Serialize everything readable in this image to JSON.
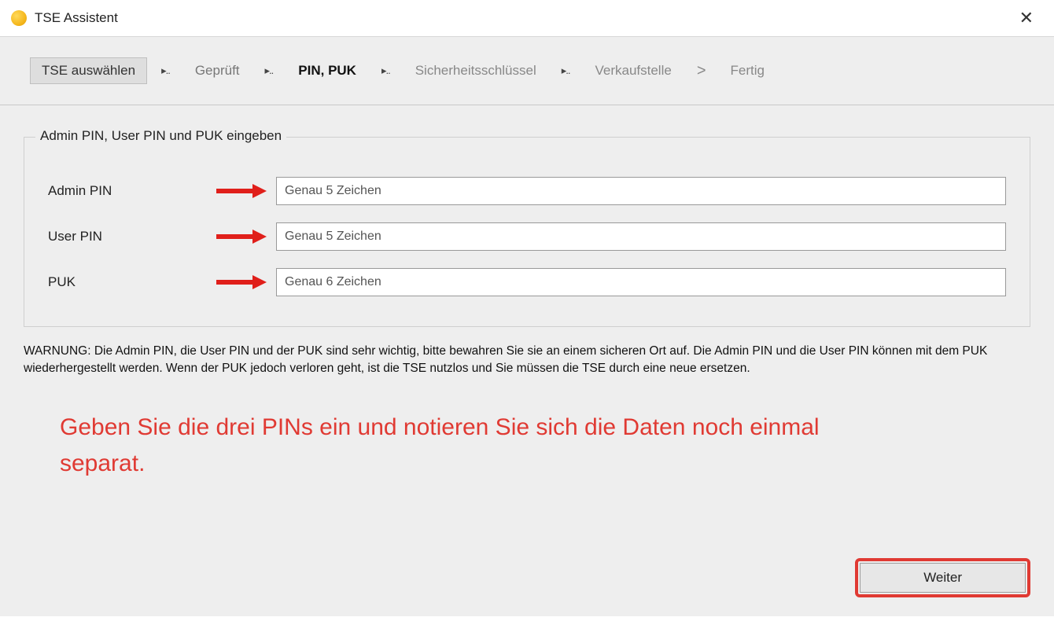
{
  "window": {
    "title": "TSE Assistent",
    "close_symbol": "✕"
  },
  "steps": {
    "s1": "TSE auswählen",
    "s2": "Geprüft",
    "s3": "PIN, PUK",
    "s4": "Sicherheitsschlüssel",
    "s5": "Verkaufstelle",
    "s6": "Fertig",
    "sep_dots": "▸..",
    "sep_last": ">"
  },
  "fieldset": {
    "legend": "Admin PIN, User PIN und PUK eingeben",
    "rows": [
      {
        "label": "Admin PIN",
        "placeholder": "Genau 5 Zeichen"
      },
      {
        "label": "User PIN",
        "placeholder": "Genau 5 Zeichen"
      },
      {
        "label": "PUK",
        "placeholder": "Genau 6 Zeichen"
      }
    ]
  },
  "warning_text": "WARNUNG: Die Admin PIN, die User PIN und der PUK sind sehr wichtig, bitte bewahren Sie sie an einem sicheren Ort auf. Die Admin PIN und die User PIN können mit dem PUK wiederhergestellt werden. Wenn der PUK jedoch verloren geht, ist die TSE nutzlos und Sie müssen die TSE durch eine neue ersetzen.",
  "annotation_text": "Geben Sie die drei PINs ein und notieren Sie sich die Daten noch einmal separat.",
  "next_button": "Weiter",
  "colors": {
    "annotation_red": "#e03a33"
  }
}
